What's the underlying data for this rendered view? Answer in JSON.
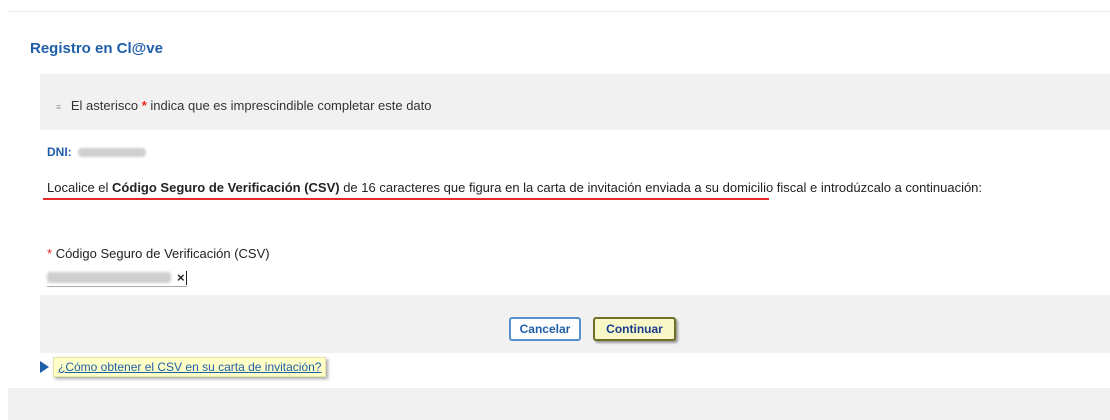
{
  "page": {
    "title": "Registro en Cl@ve"
  },
  "note": {
    "text_before": "El asterisco",
    "required_mark": "*",
    "text_after": "indica que es imprescindible completar este dato"
  },
  "dni": {
    "label": "DNI:"
  },
  "instruction": {
    "part1": "Localice el ",
    "bold": "Código Seguro de Verificación (CSV)",
    "part2": " de 16 caracteres que figura en la carta de invitación enviada a su domicilio fiscal e introdúzcalo a continuación:"
  },
  "csv_field": {
    "required_mark": "*",
    "label": "Código Seguro de Verificación (CSV)",
    "clear_symbol": "×"
  },
  "buttons": {
    "cancel": "Cancelar",
    "continue": "Continuar"
  },
  "help": {
    "link_text": "¿Cómo obtener el CSV en su carta de invitación?"
  },
  "colors": {
    "title_blue": "#1f5ea8",
    "required_red": "#e22222",
    "underline_red": "#e22a2a",
    "panel_gray": "#f1f1f1",
    "help_yellow": "#ffffc8"
  }
}
